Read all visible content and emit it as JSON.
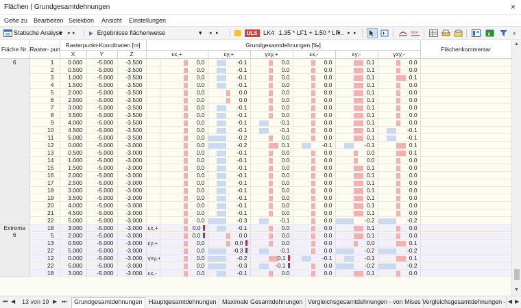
{
  "window": {
    "title": "Flächen | Grundgesamtdehnungen",
    "close": "×"
  },
  "menu": [
    "Gehe zu",
    "Bearbeiten",
    "Selektion",
    "Ansicht",
    "Einstellungen"
  ],
  "toolbar": {
    "analysis": "Statische Analyse",
    "results": "Ergebnisse flächenweise",
    "badge": "ULS",
    "lk": "LK4",
    "combo": "1.35 * LF1 + 1.50 * LF...",
    "colors": {
      "badge_yellow": "#f2c12e",
      "badge_red": "#d9403a"
    }
  },
  "table": {
    "headers": {
      "flaeche": "Fläche Nr.",
      "raster": "Raster- punkt Nr.",
      "coords": "Rasterpunkt-Koordinaten [m]",
      "x": "X",
      "y": "Y",
      "z": "Z",
      "strain_group": "Grundgesamtdehnungen [‰]",
      "exp": "εx,+",
      "eyp": "εy,+",
      "gxyp": "γxy,+",
      "exm": "εx,-",
      "eym": "εy,-",
      "gxym": "γxy,-",
      "comment": "Flächenkommentar"
    },
    "group1_label": "6",
    "extrema_label": "Extrema",
    "extrema_sub": "6",
    "rows": [
      {
        "n": "1",
        "x": "0.000",
        "y": "-5.000",
        "z": "-3.500",
        "v": [
          "0.0",
          "-0.1",
          "0.0",
          "0.0",
          "0.1",
          "0.0"
        ]
      },
      {
        "n": "2",
        "x": "0.500",
        "y": "-5.000",
        "z": "-3.500",
        "v": [
          "0.0",
          "-0.1",
          "0.0",
          "0.0",
          "0.1",
          "0.0"
        ]
      },
      {
        "n": "3",
        "x": "1.000",
        "y": "-5.000",
        "z": "-3.500",
        "v": [
          "0.0",
          "-0.1",
          "0.0",
          "0.0",
          "0.1",
          "0.1"
        ]
      },
      {
        "n": "4",
        "x": "1.500",
        "y": "-5.000",
        "z": "-3.500",
        "v": [
          "0.0",
          "-0.1",
          "0.0",
          "0.0",
          "0.1",
          "0.0"
        ]
      },
      {
        "n": "5",
        "x": "2.000",
        "y": "-5.000",
        "z": "-3.500",
        "v": [
          "0.0",
          "0.0",
          "0.0",
          "0.0",
          "0.1",
          "0.0"
        ]
      },
      {
        "n": "6",
        "x": "2.500",
        "y": "-5.000",
        "z": "-3.500",
        "v": [
          "0.0",
          "0.0",
          "0.0",
          "0.0",
          "0.1",
          "0.0"
        ]
      },
      {
        "n": "7",
        "x": "3.000",
        "y": "-5.000",
        "z": "-3.500",
        "v": [
          "0.0",
          "-0.1",
          "0.0",
          "0.0",
          "0.1",
          "0.0"
        ]
      },
      {
        "n": "8",
        "x": "3.500",
        "y": "-5.000",
        "z": "-3.500",
        "v": [
          "0.0",
          "-0.1",
          "0.0",
          "0.0",
          "0.1",
          "0.0"
        ]
      },
      {
        "n": "9",
        "x": "4.000",
        "y": "-5.000",
        "z": "-3.500",
        "v": [
          "0.0",
          "-0.1",
          "-0.1",
          "0.0",
          "0.1",
          "0.0"
        ]
      },
      {
        "n": "10",
        "x": "4.500",
        "y": "-5.000",
        "z": "-3.500",
        "v": [
          "0.0",
          "-0.1",
          "-0.1",
          "0.0",
          "0.1",
          "-0.1"
        ]
      },
      {
        "n": "11",
        "x": "5.000",
        "y": "-5.000",
        "z": "-3.500",
        "v": [
          "0.0",
          "-0.2",
          "0.0",
          "0.0",
          "0.1",
          "-0.1"
        ]
      },
      {
        "n": "12",
        "x": "0.000",
        "y": "-5.000",
        "z": "-3.000",
        "v": [
          "0.0",
          "-0.2",
          "0.1",
          "-0.1",
          "-0.1",
          "0.1"
        ]
      },
      {
        "n": "13",
        "x": "0.500",
        "y": "-5.000",
        "z": "-3.000",
        "v": [
          "0.0",
          "-0.1",
          "0.0",
          "0.0",
          "0.0",
          "0.1"
        ]
      },
      {
        "n": "14",
        "x": "1.000",
        "y": "-5.000",
        "z": "-3.000",
        "v": [
          "0.0",
          "-0.1",
          "0.0",
          "0.0",
          "0.0",
          "0.0"
        ]
      },
      {
        "n": "15",
        "x": "1.500",
        "y": "-5.000",
        "z": "-3.000",
        "v": [
          "0.0",
          "-0.1",
          "0.0",
          "0.0",
          "0.1",
          "0.0"
        ]
      },
      {
        "n": "16",
        "x": "2.000",
        "y": "-5.000",
        "z": "-3.000",
        "v": [
          "0.0",
          "-0.1",
          "0.0",
          "0.0",
          "0.1",
          "0.0"
        ]
      },
      {
        "n": "17",
        "x": "2.500",
        "y": "-5.000",
        "z": "-3.000",
        "v": [
          "0.0",
          "-0.1",
          "0.0",
          "0.0",
          "0.1",
          "0.0"
        ]
      },
      {
        "n": "18",
        "x": "3.000",
        "y": "-5.000",
        "z": "-3.000",
        "v": [
          "0.0",
          "-0.1",
          "0.0",
          "0.0",
          "0.1",
          "0.0"
        ]
      },
      {
        "n": "19",
        "x": "3.500",
        "y": "-5.000",
        "z": "-3.000",
        "v": [
          "0.0",
          "-0.1",
          "0.0",
          "0.0",
          "0.1",
          "0.0"
        ]
      },
      {
        "n": "20",
        "x": "4.000",
        "y": "-5.000",
        "z": "-3.000",
        "v": [
          "0.0",
          "-0.1",
          "0.0",
          "0.0",
          "0.1",
          "0.0"
        ]
      },
      {
        "n": "21",
        "x": "4.500",
        "y": "-5.000",
        "z": "-3.000",
        "v": [
          "0.0",
          "-0.1",
          "0.0",
          "0.0",
          "0.1",
          "0.0"
        ]
      },
      {
        "n": "22",
        "x": "5.000",
        "y": "-5.000",
        "z": "-3.000",
        "v": [
          "0.0",
          "-0.3",
          "-0.1",
          "0.0",
          "-0.2",
          "-0.2"
        ]
      }
    ],
    "extrema": [
      {
        "n": "18",
        "x": "3.000",
        "y": "-5.000",
        "z": "-3.000",
        "l": "εx,+",
        "v": [
          "0.0",
          "-0.1",
          "0.0",
          "0.0",
          "0.1",
          "0.0"
        ],
        "m": 0
      },
      {
        "n": "5",
        "x": "2.000",
        "y": "-5.000",
        "z": "-3.000",
        "l": "",
        "v": [
          "0.0",
          "0.0",
          "0.0",
          "0.0",
          "0.1",
          "0.0"
        ],
        "m": 0
      },
      {
        "n": "13",
        "x": "0.500",
        "y": "-5.000",
        "z": "-3.000",
        "l": "εy,+",
        "v": [
          "0.0",
          "0.0",
          "0.0",
          "0.0",
          "0.0",
          "0.1"
        ],
        "m": 1
      },
      {
        "n": "22",
        "x": "5.000",
        "y": "-5.000",
        "z": "-3.000",
        "l": "",
        "v": [
          "0.0",
          "-0.3",
          "-0.1",
          "0.0",
          "-0.2",
          "-0.2"
        ],
        "m": 1
      },
      {
        "n": "12",
        "x": "0.000",
        "y": "-5.000",
        "z": "-3.000",
        "l": "γxy,+",
        "v": [
          "0.0",
          "-0.2",
          "0.1",
          "-0.1",
          "-0.1",
          "0.1"
        ],
        "m": 2
      },
      {
        "n": "22",
        "x": "5.000",
        "y": "-5.000",
        "z": "-3.000",
        "l": "",
        "v": [
          "0.0",
          "-0.3",
          "-0.1",
          "0.0",
          "-0.2",
          "-0.2"
        ],
        "m": 2
      },
      {
        "n": "18",
        "x": "3.000",
        "y": "-5.000",
        "z": "-3.000",
        "l": "εx,-",
        "v": [
          "0.0",
          "-0.1",
          "0.0",
          "0.0",
          "0.1",
          "0.0"
        ],
        "m": -1
      }
    ]
  },
  "footer": {
    "page": "13 von 19",
    "tabs": [
      "Grundgesamtdehnungen",
      "Hauptgesamtdehnungen",
      "Maximale Gesamtdehnungen",
      "Vergleichsgesamtdehnungen - von Mises",
      "Vergleichsgesamtdehnungen - "
    ],
    "active_tab": 0
  }
}
